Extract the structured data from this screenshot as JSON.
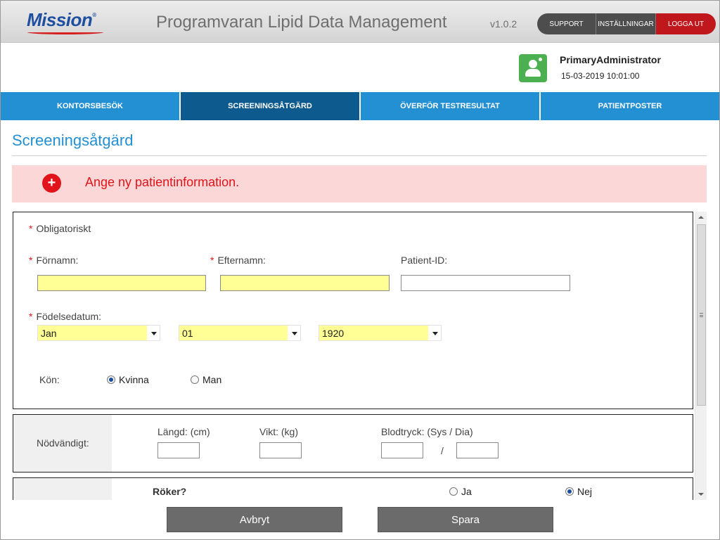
{
  "header": {
    "logo_text": "Mission",
    "logo_mark": "®",
    "app_title": "Programvaran Lipid Data Management",
    "version": "v1.0.2",
    "support_label": "SUPPORT",
    "settings_label": "INSTÄLLNINGAR",
    "logout_label": "LOGGA UT",
    "logout_color": "#c0171c"
  },
  "user": {
    "avatar_icon": "user-icon",
    "name": "PrimaryAdministrator",
    "datetime": "15-03-2019 10:01:00"
  },
  "nav": {
    "tabs": [
      {
        "label": "KONTORSBESÖK",
        "active": false
      },
      {
        "label": "SCREENINGSÅTGÄRD",
        "active": true
      },
      {
        "label": "ÖVERFÖR TESTRESULTAT",
        "active": false
      },
      {
        "label": "PATIENTPOSTER",
        "active": false
      }
    ],
    "color": "#2390d4",
    "active_color": "#0d5a8e"
  },
  "page": {
    "title": "Screeningsåtgärd"
  },
  "alert": {
    "icon": "plus-circle-icon",
    "icon_glyph": "+",
    "message": "Ange ny patientinformation."
  },
  "form": {
    "required_mark": "*",
    "required_note": "Obligatoriskt",
    "first_name_label": "Förnamn:",
    "last_name_label": "Efternamn:",
    "patient_id_label": "Patient-ID:",
    "first_name_value": "",
    "last_name_value": "",
    "patient_id_value": "",
    "dob_label": "Födelsedatum:",
    "dob_month": "Jan",
    "dob_day": "01",
    "dob_year": "1920",
    "gender_label": "Kön:",
    "gender_female": "Kvinna",
    "gender_male": "Man",
    "gender_selected": "Kvinna",
    "required_section_label": "Nödvändigt:",
    "height_label": "Längd: (cm)",
    "weight_label": "Vikt: (kg)",
    "bp_label": "Blodtryck: (Sys / Dia)",
    "bp_separator": "/",
    "smoker_question": "Röker?",
    "smoker_yes": "Ja",
    "smoker_no": "Nej",
    "smoker_selected": "Nej",
    "highlight_color": "#ffff96"
  },
  "actions": {
    "cancel_label": "Avbryt",
    "save_label": "Spara"
  }
}
